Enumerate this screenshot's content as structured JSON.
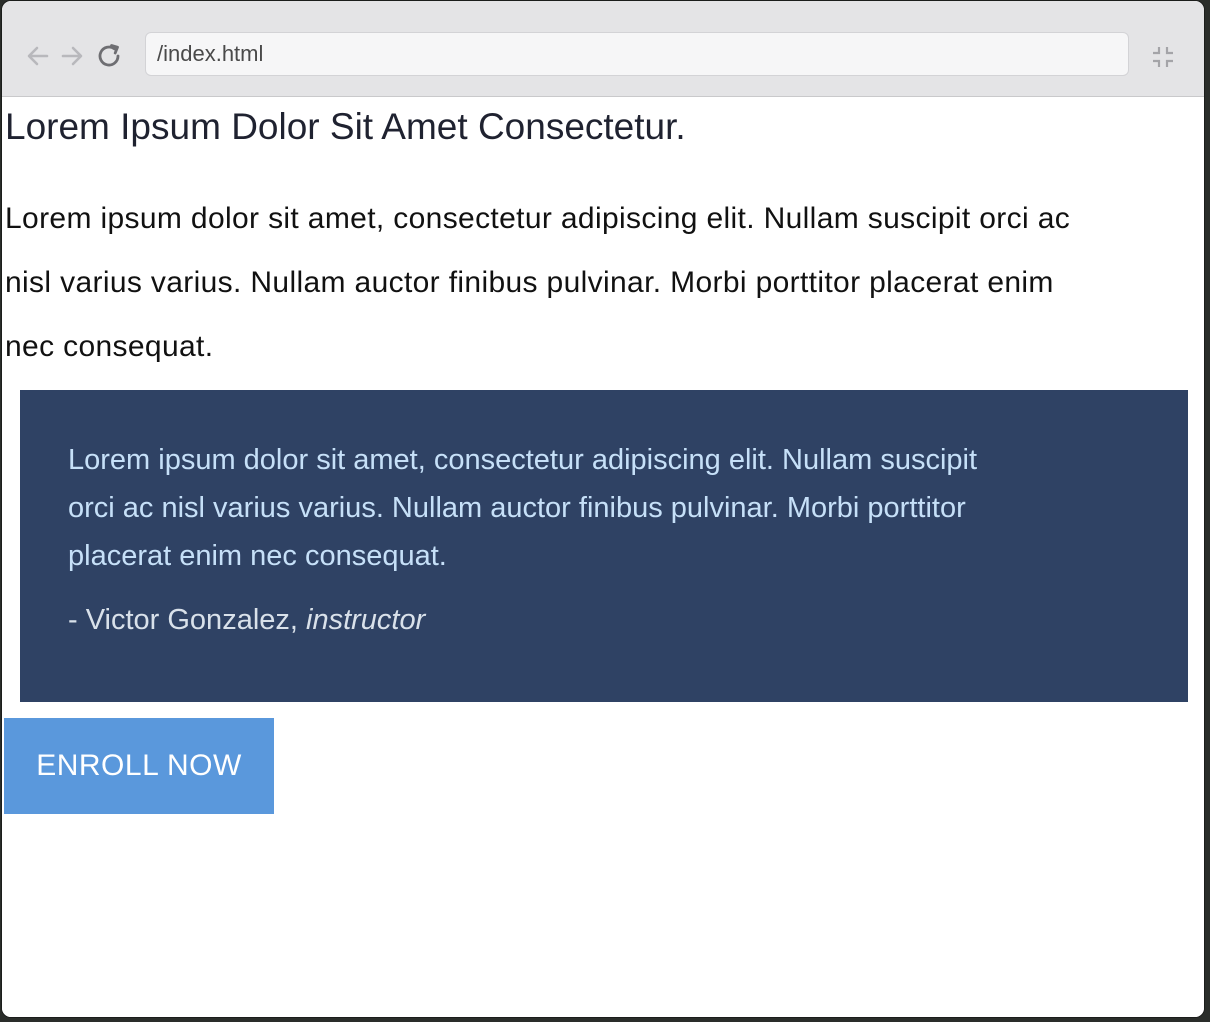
{
  "browser": {
    "address": "/index.html",
    "icons": {
      "back": "arrow-left-icon",
      "forward": "arrow-right-icon",
      "reload": "reload-icon",
      "collapse": "collapse-icon"
    }
  },
  "page": {
    "heading": "Lorem Ipsum Dolor Sit Amet Consectetur.",
    "intro_lines": [
      "Lorem ipsum dolor sit amet, consectetur adipiscing elit. Nullam suscipit orci ac",
      "nisl varius varius. Nullam auctor finibus pulvinar. Morbi porttitor placerat enim",
      "nec consequat."
    ],
    "quote": {
      "lines": [
        "Lorem ipsum dolor sit amet, consectetur adipiscing elit. Nullam suscipit",
        "orci ac nisl varius varius. Nullam auctor finibus pulvinar. Morbi porttitor",
        "placerat enim nec consequat."
      ],
      "author_prefix": "- Victor Gonzalez, ",
      "author_role": "instructor"
    },
    "cta_label": "ENROLL NOW"
  },
  "colors": {
    "toolbar": "#e4e4e6",
    "quote_background": "#2f4264",
    "quote_text": "#c6e0f8",
    "button_background": "#5a98dc",
    "button_text": "#ffffff"
  }
}
